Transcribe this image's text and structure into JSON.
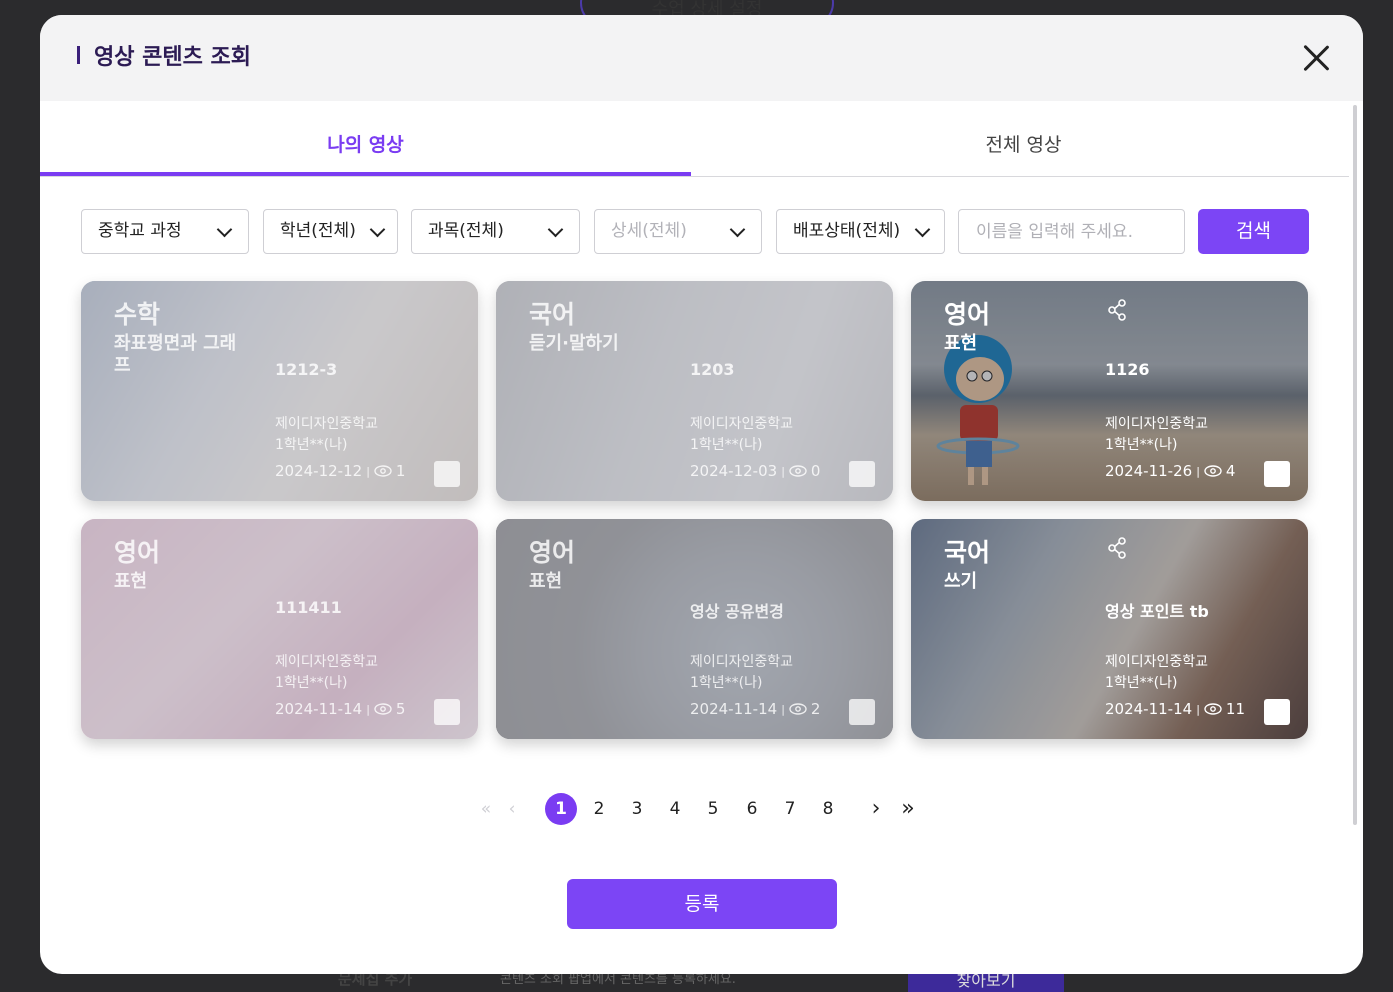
{
  "background": {
    "top_button_label": "수업 상세 설정",
    "bottom_label": "문제집 추가",
    "bottom_hint": "콘텐츠 조회 팝업에서 콘텐츠를 등록하세요.",
    "bottom_button": "찾아보기"
  },
  "modal": {
    "title": "영상 콘텐츠 조회",
    "close_icon": "close-icon"
  },
  "tabs": [
    {
      "label": "나의 영상",
      "active": true
    },
    {
      "label": "전체 영상",
      "active": false
    }
  ],
  "filters": {
    "course": "중학교 과정",
    "grade": "학년(전체)",
    "subject": "과목(전체)",
    "detail": "상세(전체)",
    "status": "배포상태(전체)",
    "search_placeholder": "이름을 입력해 주세요.",
    "search_button": "검색"
  },
  "cards": [
    {
      "subject": "수학",
      "unit": "좌표평면과 그래프",
      "title": "1212-3",
      "school": "제이디자인중학교",
      "grade": "1학년**(나)",
      "date": "2024-12-12",
      "views": "1",
      "shared": false,
      "dim": true
    },
    {
      "subject": "국어",
      "unit": "듣기·말하기",
      "title": "1203",
      "school": "제이디자인중학교",
      "grade": "1학년**(나)",
      "date": "2024-12-03",
      "views": "0",
      "shared": false,
      "dim": true
    },
    {
      "subject": "영어",
      "unit": "표현",
      "title": "1126",
      "school": "제이디자인중학교",
      "grade": "1학년**(나)",
      "date": "2024-11-26",
      "views": "4",
      "shared": true,
      "dim": false
    },
    {
      "subject": "영어",
      "unit": "표현",
      "title": "111411",
      "school": "제이디자인중학교",
      "grade": "1학년**(나)",
      "date": "2024-11-14",
      "views": "5",
      "shared": false,
      "dim": true
    },
    {
      "subject": "영어",
      "unit": "표현",
      "title": "영상 공유변경",
      "school": "제이디자인중학교",
      "grade": "1학년**(나)",
      "date": "2024-11-14",
      "views": "2",
      "shared": false,
      "dim": true
    },
    {
      "subject": "국어",
      "unit": "쓰기",
      "title": "영상 포인트 tb",
      "school": "제이디자인중학교",
      "grade": "1학년**(나)",
      "date": "2024-11-14",
      "views": "11",
      "shared": true,
      "dim": false
    }
  ],
  "pagination": {
    "pages": [
      "1",
      "2",
      "3",
      "4",
      "5",
      "6",
      "7",
      "8"
    ],
    "current": "1",
    "first": "«",
    "prev": "‹",
    "next": "›",
    "last": "»"
  },
  "register_button": "등록",
  "colors": {
    "accent": "#7c45f5",
    "title": "#2c1b54"
  }
}
